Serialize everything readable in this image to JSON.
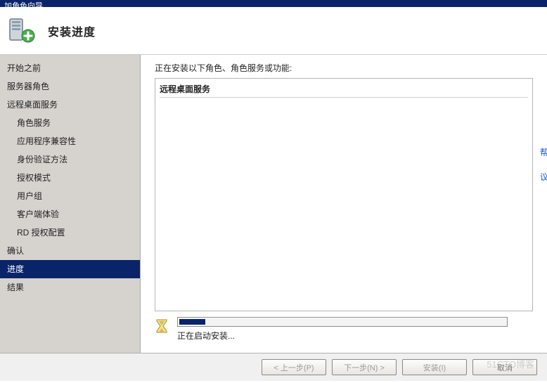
{
  "window_title": "加角色向导",
  "header": {
    "title": "安装进度"
  },
  "sidebar": {
    "items": [
      {
        "label": "开始之前",
        "indent": false
      },
      {
        "label": "服务器角色",
        "indent": false
      },
      {
        "label": "远程桌面服务",
        "indent": false
      },
      {
        "label": "角色服务",
        "indent": true
      },
      {
        "label": "应用程序兼容性",
        "indent": true
      },
      {
        "label": "身份验证方法",
        "indent": true
      },
      {
        "label": "授权模式",
        "indent": true
      },
      {
        "label": "用户组",
        "indent": true
      },
      {
        "label": "客户端体验",
        "indent": true
      },
      {
        "label": "RD 授权配置",
        "indent": true
      },
      {
        "label": "确认",
        "indent": false
      },
      {
        "label": "进度",
        "indent": false,
        "selected": true
      },
      {
        "label": "结果",
        "indent": false
      }
    ]
  },
  "content": {
    "installing_label": "正在安装以下角色、角色服务或功能:",
    "items": [
      "远程桌面服务"
    ],
    "progress": {
      "percent": 8,
      "status_text": "正在启动安装..."
    }
  },
  "right_hints": [
    "帮",
    "议"
  ],
  "footer": {
    "prev": "< 上一步(P)",
    "next": "下一步(N) >",
    "install": "安装(I)",
    "cancel": "取消"
  },
  "watermark": "51CTO博客"
}
